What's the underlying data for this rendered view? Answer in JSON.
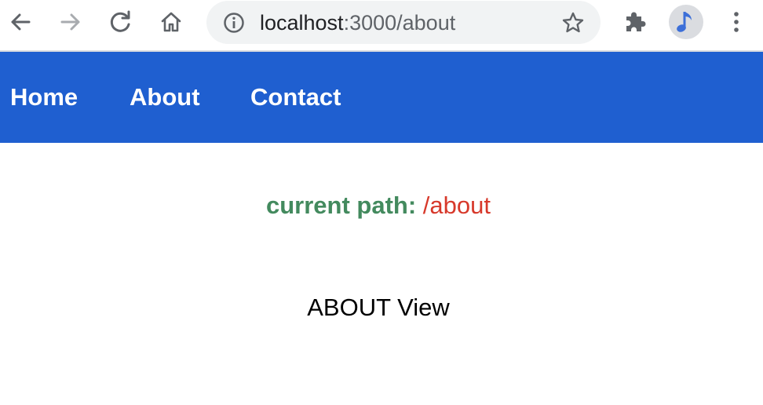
{
  "browser": {
    "url_host": "localhost",
    "url_path": ":3000/about",
    "icons": {
      "back": "arrow-left-icon",
      "forward": "arrow-right-icon",
      "reload": "reload-icon",
      "home": "home-icon",
      "info": "info-icon",
      "bookmark": "star-icon",
      "extensions": "puzzle-icon",
      "profile": "music-note-avatar",
      "menu": "kebab-menu-icon"
    },
    "colors": {
      "icon": "#5f6368",
      "icon_disabled": "#a8abaf",
      "omnibox_bg": "#f1f3f4",
      "avatar_note": "#3c6fd8"
    }
  },
  "nav": {
    "background": "#1f5fd0",
    "items": [
      {
        "label": "Home"
      },
      {
        "label": "About"
      },
      {
        "label": "Contact"
      }
    ]
  },
  "main": {
    "current_path_label": "current path:",
    "current_path_value": "/about",
    "view_title": "ABOUT View",
    "colors": {
      "label": "#438a5e",
      "value": "#d7392b"
    }
  }
}
